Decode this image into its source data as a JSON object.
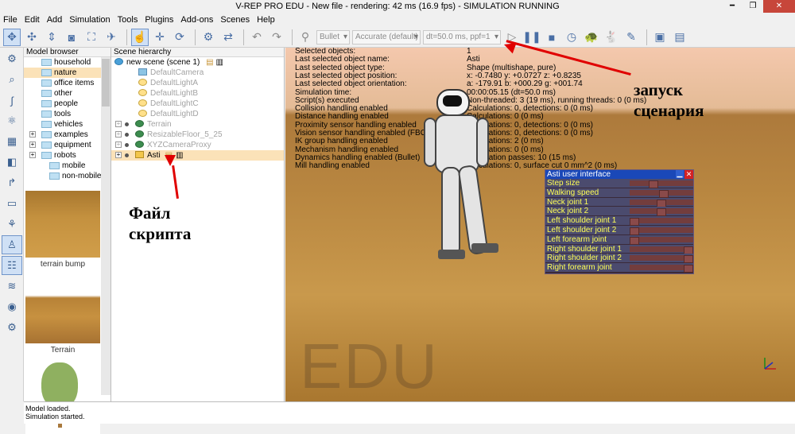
{
  "window": {
    "title": "V-REP PRO EDU - New file - rendering: 42 ms (16.9 fps) - SIMULATION RUNNING"
  },
  "menu": [
    "File",
    "Edit",
    "Add",
    "Simulation",
    "Tools",
    "Plugins",
    "Add-ons",
    "Scenes",
    "Help"
  ],
  "toolbar": {
    "engine": "Bullet",
    "accuracy": "Accurate (default)",
    "timestep": "dt=50.0 ms, ppf=1"
  },
  "model_browser": {
    "title": "Model browser",
    "items": [
      {
        "label": "household",
        "level": 0,
        "expandable": false
      },
      {
        "label": "nature",
        "level": 0,
        "expandable": false,
        "selected": true
      },
      {
        "label": "office items",
        "level": 0,
        "expandable": false
      },
      {
        "label": "other",
        "level": 0,
        "expandable": false
      },
      {
        "label": "people",
        "level": 0,
        "expandable": false
      },
      {
        "label": "tools",
        "level": 0,
        "expandable": false
      },
      {
        "label": "vehicles",
        "level": 0,
        "expandable": false
      },
      {
        "label": "examples",
        "level": 0,
        "expandable": true
      },
      {
        "label": "equipment",
        "level": 0,
        "expandable": true
      },
      {
        "label": "robots",
        "level": 0,
        "expandable": true
      },
      {
        "label": "mobile",
        "level": 1,
        "expandable": false
      },
      {
        "label": "non-mobile",
        "level": 1,
        "expandable": false
      }
    ],
    "thumbnails": [
      "terrain bump",
      "Terrain"
    ]
  },
  "hierarchy": {
    "title": "Scene hierarchy",
    "root": "new scene (scene 1)",
    "items": [
      {
        "label": "DefaultCamera",
        "type": "cam",
        "dim": true
      },
      {
        "label": "DefaultLightA",
        "type": "light",
        "dim": true
      },
      {
        "label": "DefaultLightB",
        "type": "light",
        "dim": true
      },
      {
        "label": "DefaultLightC",
        "type": "light",
        "dim": true
      },
      {
        "label": "DefaultLightD",
        "type": "light",
        "dim": true
      },
      {
        "label": "Terrain",
        "type": "ball",
        "dim": true
      },
      {
        "label": "ResizableFloor_5_25",
        "type": "ball",
        "dim": true
      },
      {
        "label": "XYZCameraProxy",
        "type": "ball",
        "dim": true
      },
      {
        "label": "Asti",
        "type": "shape",
        "dim": false,
        "selected": true
      }
    ]
  },
  "info": {
    "rows": [
      {
        "k": "Selected objects:",
        "v": "1"
      },
      {
        "k": "Last selected object name:",
        "v": "Asti"
      },
      {
        "k": "Last selected object type:",
        "v": "Shape (multishape, pure)"
      },
      {
        "k": "Last selected object position:",
        "v": "x: -0.7480   y: +0.0727   z: +0.8235"
      },
      {
        "k": "Last selected object orientation:",
        "v": "a: -179.91   b: +000.29   g: +001.74"
      },
      {
        "k": "Simulation time:",
        "v": "00:00:05.15 (dt=50.0 ms)"
      },
      {
        "k": "Script(s) executed",
        "v": "Non-threaded: 3 (19 ms), running threads: 0 (0 ms)"
      },
      {
        "k": "Collision handling enabled",
        "v": "Calculations: 0, detections: 0 (0 ms)"
      },
      {
        "k": "Distance handling enabled",
        "v": "Calculations: 0 (0 ms)"
      },
      {
        "k": "Proximity sensor handling enabled",
        "v": "Calculations: 0, detections: 0 (0 ms)"
      },
      {
        "k": "Vision sensor handling enabled (FBO)",
        "v": "Calculations: 0, detections: 0 (0 ms)"
      },
      {
        "k": "IK group handling enabled",
        "v": "Calculations: 2 (0 ms)"
      },
      {
        "k": "Mechanism handling enabled",
        "v": "Calculations: 0 (0 ms)"
      },
      {
        "k": "Dynamics handling enabled (Bullet)",
        "v": "Calculation passes: 10 (15 ms)"
      },
      {
        "k": "Mill handling enabled",
        "v": "Calculations: 0, surface cut 0 mm^2 (0 ms)"
      }
    ]
  },
  "watermark": "EDU",
  "custom_ui": {
    "title": "Asti user interface",
    "rows": [
      {
        "label": "Step size",
        "value": 0.35
      },
      {
        "label": "Walking speed",
        "value": 0.55
      },
      {
        "label": "Neck joint 1",
        "value": 0.5
      },
      {
        "label": "Neck joint 2",
        "value": 0.5
      },
      {
        "label": "Left shoulder joint 1",
        "value": 0.0
      },
      {
        "label": "Left shoulder joint 2",
        "value": 0.0
      },
      {
        "label": "Left forearm joint",
        "value": 0.0
      },
      {
        "label": "Right shoulder joint 1",
        "value": 1.0
      },
      {
        "label": "Right shoulder joint 2",
        "value": 1.0
      },
      {
        "label": "Right forearm joint",
        "value": 1.0
      }
    ]
  },
  "status": {
    "lines": [
      "Model loaded.",
      "Simulation started."
    ]
  },
  "annotations": {
    "script_file": "Файл\nскрипта",
    "start_scenario": "запуск\nсценария"
  }
}
